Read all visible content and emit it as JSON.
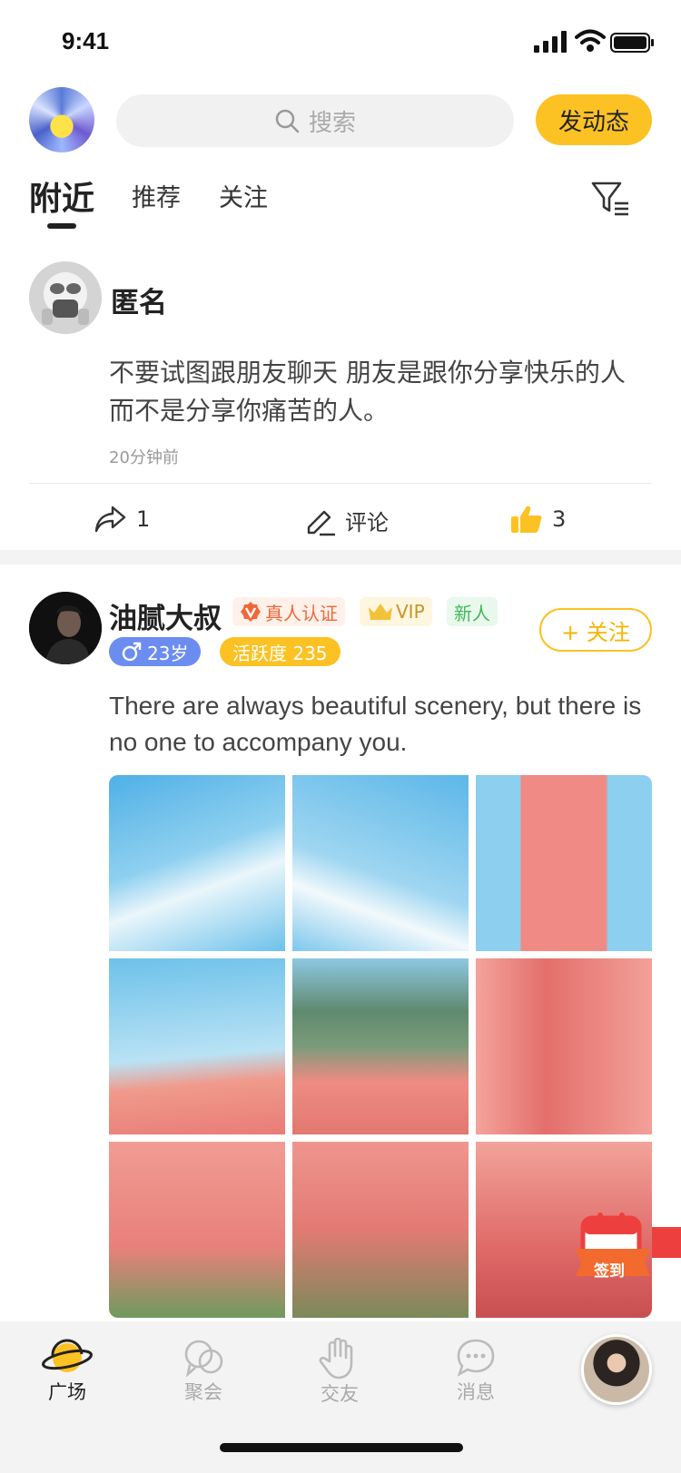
{
  "status_bar": {
    "time": "9:41"
  },
  "header": {
    "search_placeholder": "搜索",
    "post_button": "发动态"
  },
  "tabs": [
    {
      "label": "附近"
    },
    {
      "label": "推荐"
    },
    {
      "label": "关注"
    }
  ],
  "posts": [
    {
      "name": "匿名",
      "content": "不要试图跟朋友聊天 朋友是跟你分享快乐的人 而不是分享你痛苦的人。",
      "timestamp": "20分钟前",
      "shares": "1",
      "comment_label": "评论",
      "likes": "3"
    },
    {
      "name": "油腻大叔",
      "badges": {
        "verified": "真人认证",
        "vip": "VIP",
        "new": "新人"
      },
      "age": "23岁",
      "activity": "活跃度 235",
      "follow_label": "+ 关注",
      "content": "There are always beautiful scenery, but there is no one to accompany you.",
      "photo_count": 9
    }
  ],
  "signin_label": "签到",
  "nav": [
    {
      "label": "广场",
      "icon": "planet-icon"
    },
    {
      "label": "聚会",
      "icon": "bubbles-icon"
    },
    {
      "label": "交友",
      "icon": "hand-icon"
    },
    {
      "label": "消息",
      "icon": "chat-icon"
    }
  ],
  "colors": {
    "accent": "#fcc223",
    "age_chip": "#6b8df0",
    "verify": "#f0673a",
    "new": "#3fb85a"
  }
}
